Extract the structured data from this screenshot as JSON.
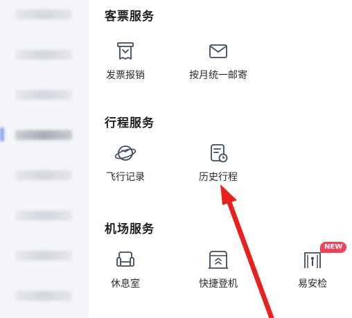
{
  "sidebar": {
    "items": [
      "",
      "",
      "",
      "",
      "",
      "",
      "",
      "",
      "",
      "",
      ""
    ],
    "active_index": 4
  },
  "sections": [
    {
      "title": "客票服务",
      "items": [
        {
          "label": "发票报销",
          "icon": "invoice-icon"
        },
        {
          "label": "按月统一邮寄",
          "icon": "mail-icon"
        }
      ]
    },
    {
      "title": "行程服务",
      "items": [
        {
          "label": "飞行记录",
          "icon": "flight-record-icon"
        },
        {
          "label": "历史行程",
          "icon": "history-trip-icon"
        }
      ]
    },
    {
      "title": "机场服务",
      "items": [
        {
          "label": "休息室",
          "icon": "lounge-icon"
        },
        {
          "label": "快捷登机",
          "icon": "fast-boarding-icon"
        },
        {
          "label": "易安检",
          "icon": "security-check-icon",
          "badge": "NEW"
        }
      ]
    }
  ],
  "colors": {
    "accent_badge": "#f2425a",
    "annotation_arrow": "#e8201e",
    "sidebar_bg": "#f4f5f8",
    "sidebar_active": "#8fa6ea"
  }
}
